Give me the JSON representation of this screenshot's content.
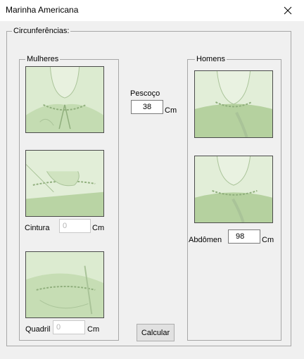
{
  "window": {
    "title": "Marinha Americana"
  },
  "group_main": {
    "label": "Circunferências:"
  },
  "women": {
    "label": "Mulheres",
    "waist_label": "Cintura",
    "waist_value": "0",
    "waist_unit": "Cm",
    "hip_label": "Quadril",
    "hip_value": "0",
    "hip_unit": "Cm"
  },
  "men": {
    "label": "Homens",
    "abdomen_label": "Abdômen",
    "abdomen_value": "98",
    "abdomen_unit": "Cm"
  },
  "neck": {
    "label": "Pescoço",
    "value": "38",
    "unit": "Cm"
  },
  "actions": {
    "calculate_label": "Calcular"
  },
  "icons": {
    "close": "close-icon"
  },
  "colors": {
    "photo_tint": "#cfe3c1",
    "photo_line": "#a9c398"
  }
}
